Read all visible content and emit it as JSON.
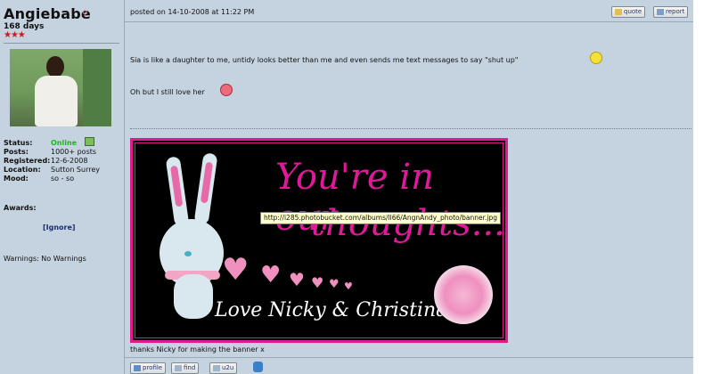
{
  "user": {
    "name": "Angiebabe",
    "gender_symbol": "♀",
    "days": "168 days",
    "rating_stars": "★★★",
    "stats": [
      {
        "label": "Status:",
        "value": "Online"
      },
      {
        "label": "Posts:",
        "value": "1000+ posts"
      },
      {
        "label": "Registered:",
        "value": "12-6-2008"
      },
      {
        "label": "Location:",
        "value": "Sutton Surrey"
      },
      {
        "label": "Mood:",
        "value": "so - so"
      }
    ],
    "awards_label": "Awards:",
    "ignore_label": "[Ignore]",
    "warnings_text": "Warnings: No Warnings"
  },
  "post": {
    "posted_on": "posted on 14-10-2008 at 11:22 PM",
    "quote_label": "quote",
    "report_label": "report",
    "line1": "Sia is like a daughter to me, untidy looks better than me and even sends me text messages to say \"shut up\"",
    "line2": "Oh but I still love her",
    "banner": {
      "title_line1": "You're in our",
      "title_line2": "thoughts...",
      "love_line": "Love Nicky & Christina x"
    },
    "tooltip": "http://i285.photobucket.com/albums/ll66/AngnAndy_photo/banner.jpg",
    "caption": "thanks Nicky for making the banner x"
  },
  "footer_buttons": {
    "profile": "profile",
    "find": "find",
    "u2u": "u2u"
  },
  "colors": {
    "panel_bg": "#c5d3e0",
    "online": "#1db51d",
    "accent_pink": "#e01a8d",
    "link_navy": "#1a2e73"
  }
}
